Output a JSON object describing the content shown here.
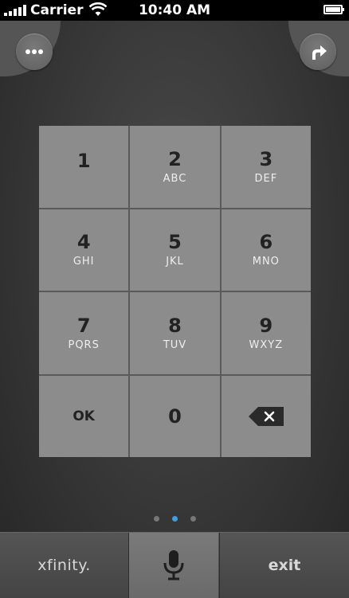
{
  "status_bar": {
    "carrier": "Carrier",
    "time": "10:40 AM"
  },
  "header": {
    "more_icon": "more-dots-icon",
    "share_icon": "share-arrow-icon"
  },
  "keypad": {
    "keys": [
      {
        "number": "1",
        "letters": ""
      },
      {
        "number": "2",
        "letters": "ABC"
      },
      {
        "number": "3",
        "letters": "DEF"
      },
      {
        "number": "4",
        "letters": "GHI"
      },
      {
        "number": "5",
        "letters": "JKL"
      },
      {
        "number": "6",
        "letters": "MNO"
      },
      {
        "number": "7",
        "letters": "PQRS"
      },
      {
        "number": "8",
        "letters": "TUV"
      },
      {
        "number": "9",
        "letters": "WXYZ"
      }
    ],
    "ok_label": "OK",
    "zero": "0",
    "backspace_icon": "backspace-icon"
  },
  "page_indicator": {
    "count": 3,
    "active_index": 1
  },
  "tabbar": {
    "brand": "xfinity.",
    "mic_icon": "microphone-icon",
    "exit_label": "exit"
  },
  "colors": {
    "active_dot": "#3ea0e0",
    "key_bg": "#8c8c8c"
  }
}
